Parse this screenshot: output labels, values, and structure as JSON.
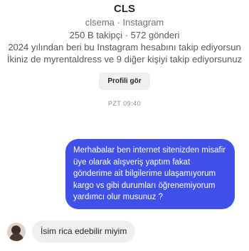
{
  "profile": {
    "name": "CLS",
    "handle_line": "clsema · Instagram",
    "stats_line": "250 B takipçi · 572 gönderi",
    "follow_since": "2024 yılından beri bu Instagram hesabını takip ediyorsun",
    "mutuals": "İkiniz de myrentaldress ve 9 diğer kişiyi takip ediyorsunuz",
    "view_profile_label": "Profili gör"
  },
  "conversation": {
    "timestamp": "PZT 09:40",
    "messages": [
      {
        "direction": "outgoing",
        "text": "Merhabalar ben internet sitenizden misafir üye olarak alışveriş yaptım fakat gönderime ait bilgilerime ulaşamıyorum kargo vs gibi durumları öğrenemiyorum yardımcı olur musunuz ?"
      },
      {
        "direction": "incoming",
        "text": "İsim rica edebilir miyim"
      }
    ]
  },
  "colors": {
    "outgoing_bubble": "#3f51e8",
    "incoming_bubble": "#efefef"
  }
}
